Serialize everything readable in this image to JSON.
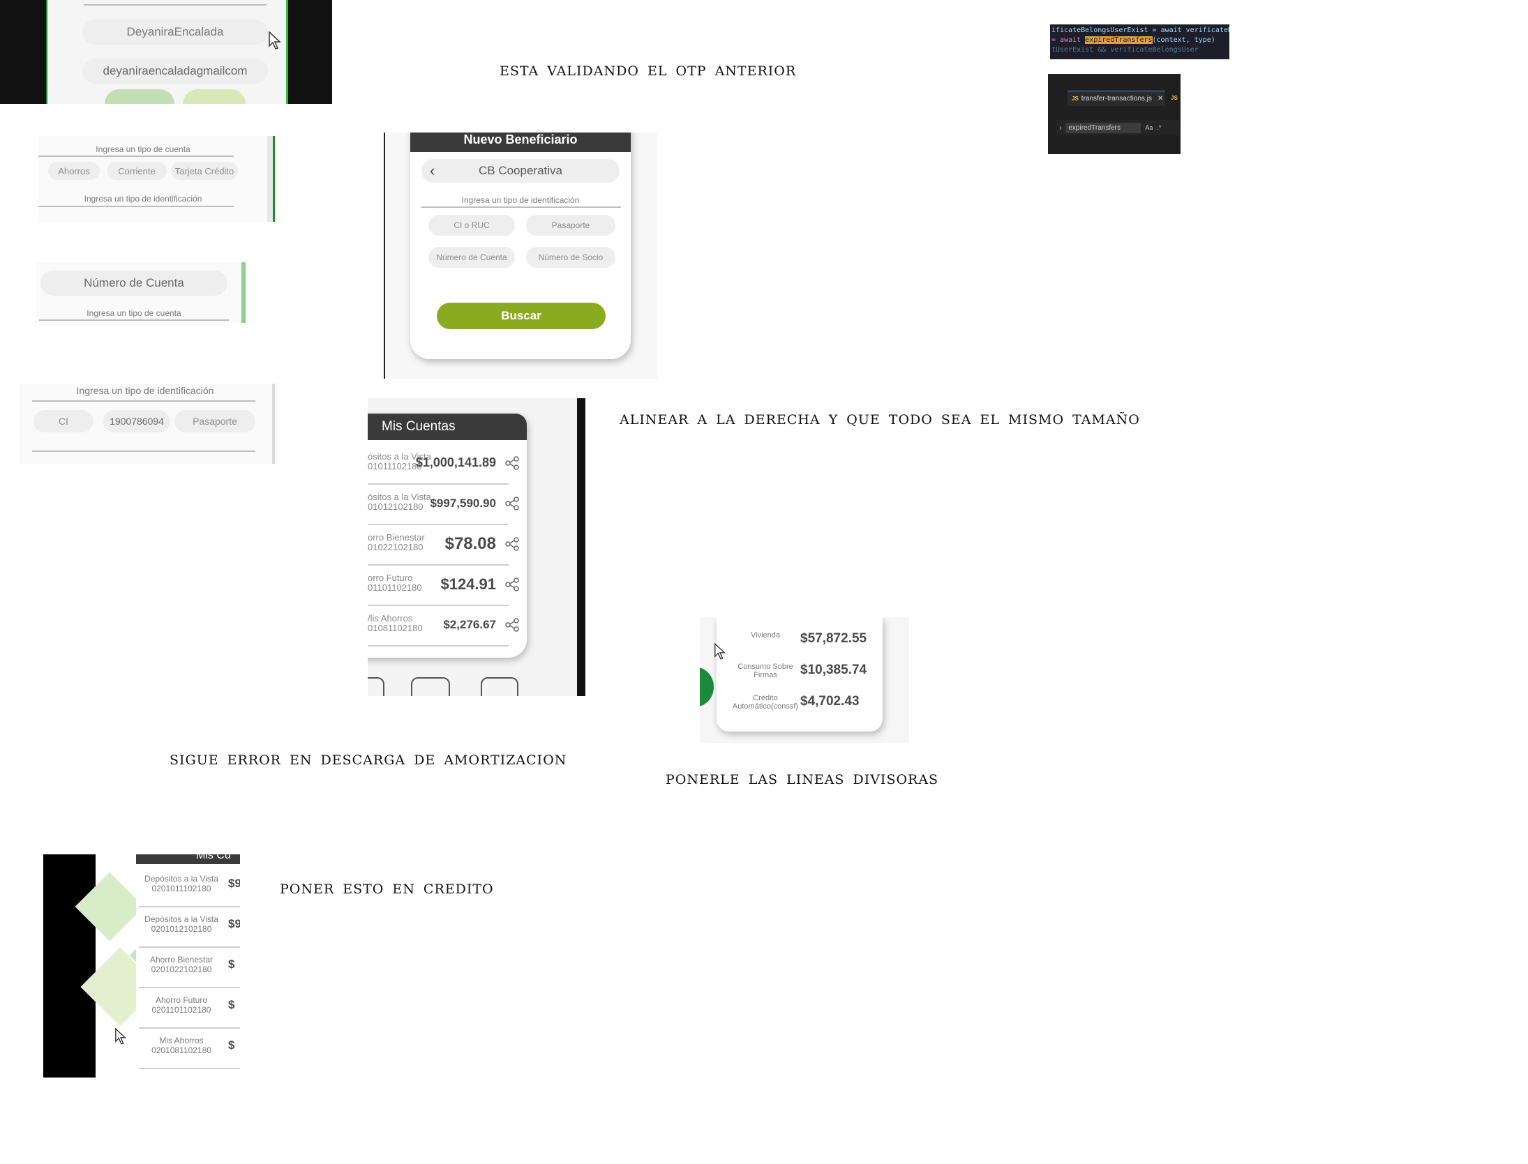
{
  "notes": {
    "otp": "ESTA VALIDANDO EL OTP ANTERIOR",
    "align": "ALINEAR A LA DERECHA Y QUE TODO SEA EL MISMO TAMAÑO",
    "amortization": "SIGUE ERROR EN DESCARGA DE AMORTIZACION",
    "dividers": "PONERLE LAS LINEAS DIVISORAS",
    "credit": "PONER ESTO EN CREDITO"
  },
  "user_fields": {
    "name": "DeyaniraEncalada",
    "email": "deyaniraencaladagmailcom"
  },
  "account_type_crop": {
    "account_label": "Ingresa un tipo de cuenta",
    "options": [
      "Ahorros",
      "Corriente",
      "Tarjeta Crédito"
    ],
    "id_label": "Ingresa un tipo de identificación"
  },
  "account_number_crop": {
    "field": "Número de Cuenta",
    "label": "Ingresa un tipo de cuenta"
  },
  "id_crop": {
    "label": "Ingresa un tipo de identificación",
    "options": [
      "CI",
      "1900786094",
      "Pasaporte"
    ]
  },
  "beneficiary": {
    "title": "Nuevo Beneficiario",
    "bank": "CB Cooperativa",
    "id_label": "Ingresa un tipo de identificación",
    "options": [
      "CI o RUC",
      "Pasaporte",
      "Número de Cuenta",
      "Número de Socio"
    ],
    "search_button": "Buscar"
  },
  "accounts": {
    "title": "Mis Cuentas",
    "rows": [
      {
        "name": "ósitos a la Vista",
        "number": "01011102180",
        "amount": "$1,000,141.89"
      },
      {
        "name": "ósitos a la Vista",
        "number": "01012102180",
        "amount": "$997,590.90"
      },
      {
        "name": "orro Bienestar",
        "number": "01022102180",
        "amount": "$78.08"
      },
      {
        "name": "orro Futuro",
        "number": "01101102180",
        "amount": "$124.91"
      },
      {
        "name": "/lis Ahorros",
        "number": "01081102180",
        "amount": "$2,276.67"
      }
    ]
  },
  "credits": {
    "rows": [
      {
        "name": "Vivienda",
        "amount": "$57,872.55"
      },
      {
        "name": "Consumo Sobre Firmas",
        "amount": "$10,385.74"
      },
      {
        "name": "Crédito Automático(conssf)",
        "amount": "$4,702.43"
      }
    ]
  },
  "accounts_small": {
    "title": "Mis Cu",
    "rows": [
      {
        "name": "Depósitos a la Vista",
        "number": "0201011102180",
        "amount": "$9"
      },
      {
        "name": "Depósitos a la Vista",
        "number": "0201012102180",
        "amount": "$9"
      },
      {
        "name": "Ahorro Bienestar",
        "number": "0201022102180",
        "amount": "$"
      },
      {
        "name": "Ahorro Futuro",
        "number": "0201101102180",
        "amount": "$"
      },
      {
        "name": "Mis Ahorros",
        "number": "0201081102180",
        "amount": "$"
      }
    ]
  },
  "code_snippet": {
    "line1": "ificateBelongsUserExist = await verificateBe",
    "line2_prefix": "= await ",
    "line2_highlight": "expiredTransfers",
    "line2_args": "(context, type)",
    "line3": "tUserExist && verificateBelongsUser"
  },
  "vscode": {
    "tab_label": "transfer-transactions.js",
    "tab_icon": "JS",
    "search_value": "expiredTransfers",
    "case_option": "Aa"
  },
  "colors": {
    "brand_green": "#8aab1f",
    "dark_header": "#3a3a3a",
    "accent_green": "#1b8a3c"
  }
}
